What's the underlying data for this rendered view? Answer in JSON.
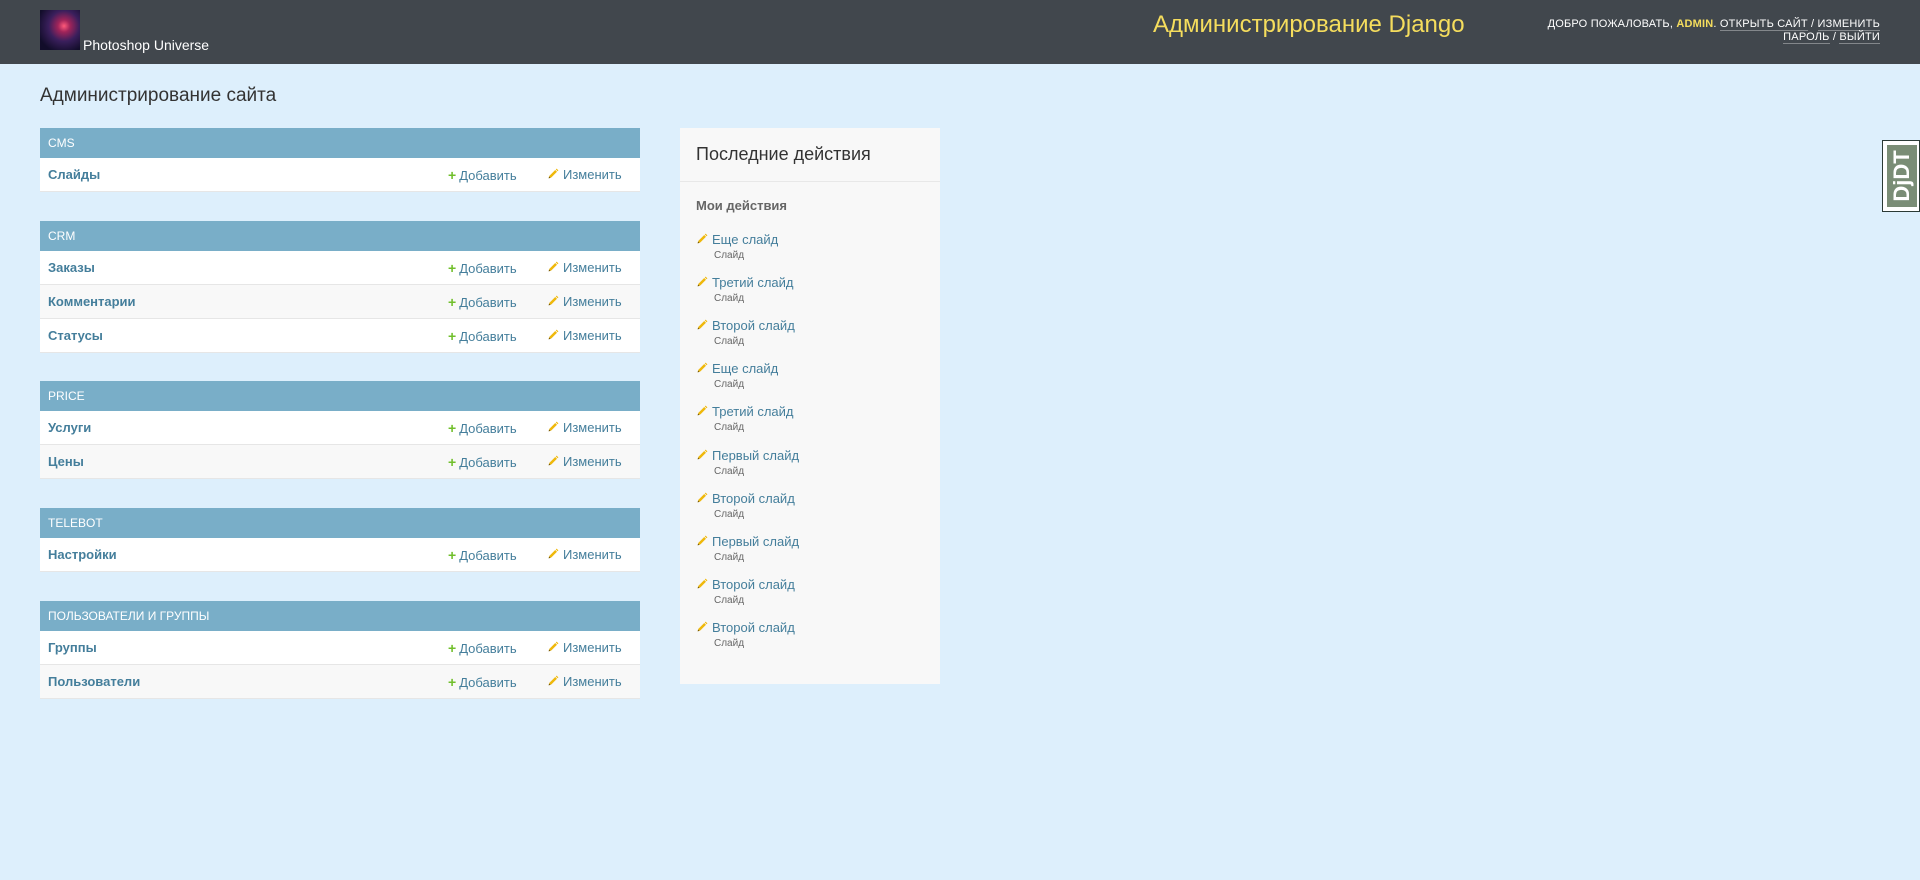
{
  "header": {
    "brand": "Photoshop Universe",
    "site_title": "Администрирование Django",
    "welcome_text": "Добро пожаловать,",
    "username": "admin",
    "open_site": "Открыть сайт",
    "change_password": "Изменить пароль",
    "logout": "Выйти",
    "separator": "/",
    "colors": {
      "header_bg": "#41474d",
      "title": "#f5dd5d"
    }
  },
  "page_title": "Администрирование сайта",
  "add_label": "Добавить",
  "change_label": "Изменить",
  "modules": [
    {
      "caption": "CMS",
      "models": [
        {
          "name": "Слайды"
        }
      ]
    },
    {
      "caption": "CRM",
      "models": [
        {
          "name": "Заказы"
        },
        {
          "name": "Комментарии"
        },
        {
          "name": "Статусы"
        }
      ]
    },
    {
      "caption": "PRICE",
      "models": [
        {
          "name": "Услуги"
        },
        {
          "name": "Цены"
        }
      ]
    },
    {
      "caption": "TELEBOT",
      "models": [
        {
          "name": "Настройки"
        }
      ]
    },
    {
      "caption": "Пользователи и группы",
      "models": [
        {
          "name": "Группы"
        },
        {
          "name": "Пользователи"
        }
      ]
    }
  ],
  "recent": {
    "title": "Последние действия",
    "subtitle": "Мои действия",
    "items": [
      {
        "label": "Еще слайд",
        "type": "Слайд"
      },
      {
        "label": "Третий слайд",
        "type": "Слайд"
      },
      {
        "label": "Второй слайд",
        "type": "Слайд"
      },
      {
        "label": "Еще слайд",
        "type": "Слайд"
      },
      {
        "label": "Третий слайд",
        "type": "Слайд"
      },
      {
        "label": "Первый слайд",
        "type": "Слайд"
      },
      {
        "label": "Второй слайд",
        "type": "Слайд"
      },
      {
        "label": "Первый слайд",
        "type": "Слайд"
      },
      {
        "label": "Второй слайд",
        "type": "Слайд"
      },
      {
        "label": "Второй слайд",
        "type": "Слайд"
      }
    ]
  },
  "debug_toolbar": {
    "label": "DjDT"
  },
  "icons": {
    "add": "plus-icon",
    "change": "pencil-icon"
  },
  "colors": {
    "page_bg": "#ddeffc",
    "module_caption": "#79aec8",
    "link": "#447e9b",
    "add_icon": "#70bf2b",
    "pencil": "#efb80b"
  }
}
